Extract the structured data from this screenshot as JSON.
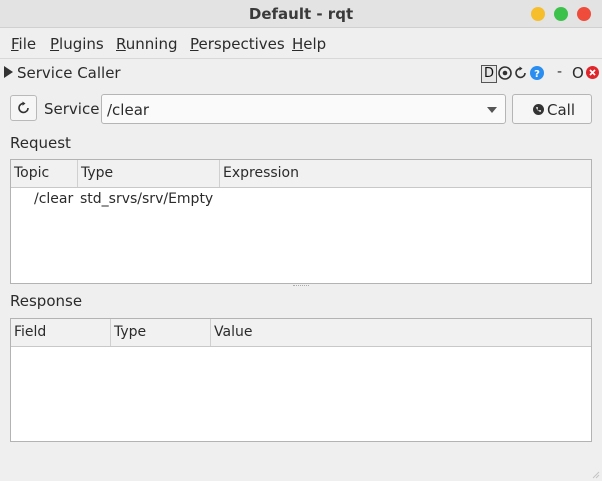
{
  "window": {
    "title": "Default - rqt"
  },
  "menu": [
    {
      "label": "File",
      "accel": "F",
      "rest": "ile"
    },
    {
      "label": "Plugins",
      "accel": "P",
      "rest": "lugins"
    },
    {
      "label": "Running",
      "accel": "R",
      "rest": "unning"
    },
    {
      "label": "Perspectives",
      "accel": "P",
      "rest": "erspectives"
    },
    {
      "label": "Help",
      "accel": "H",
      "rest": "elp"
    }
  ],
  "plugin": {
    "title": "Service Caller",
    "d_label": "D",
    "minus_label": "-",
    "restore_label": "O",
    "icons": [
      "gear-icon",
      "reload-icon",
      "help-icon",
      "close-icon"
    ]
  },
  "toolbar": {
    "service_label": "Service",
    "service_value": "/clear",
    "call_label": "Call"
  },
  "request": {
    "label": "Request",
    "columns": [
      "Topic",
      "Type",
      "Expression"
    ],
    "rows": [
      {
        "topic": "/clear",
        "type": "std_srvs/srv/Empty",
        "expression": ""
      }
    ]
  },
  "response": {
    "label": "Response",
    "columns": [
      "Field",
      "Type",
      "Value"
    ],
    "rows": []
  },
  "colors": {
    "help_blue": "#2a8ef0",
    "close_red": "#e0262b",
    "min_yellow": "#f6be2b",
    "max_green": "#3cc24a"
  }
}
